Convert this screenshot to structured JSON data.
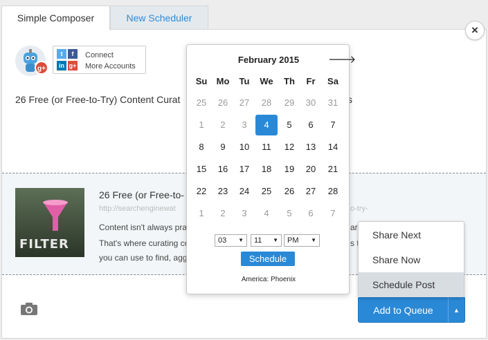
{
  "tabs": [
    {
      "label": "Simple Composer"
    },
    {
      "label": "New Scheduler"
    }
  ],
  "close": "×",
  "connect": {
    "line1": "Connect",
    "line2": "More Accounts"
  },
  "social_icons": [
    "t",
    "f",
    "in",
    "g+"
  ],
  "avatar_badge": "g+",
  "post": {
    "text": "26 Free (or Free-to-Try) Content Curat",
    "text_end": "s"
  },
  "link_preview": {
    "title": "26 Free (or Free-to-",
    "url": "http://searchenginewat",
    "url_end": "o-try-",
    "desc_lines": [
      {
        "start": "Content isn't always pra",
        "end": "ar"
      },
      {
        "start": "That's where curating co",
        "end": "s to"
      },
      {
        "start": "you can use to find, agg",
        "end": ""
      }
    ],
    "thumbnail_label": "FILTER"
  },
  "calendar": {
    "month": "February 2015",
    "next_icon": "🡒",
    "weekdays": [
      "Su",
      "Mo",
      "Tu",
      "We",
      "Th",
      "Fr",
      "Sa"
    ],
    "weeks": [
      [
        {
          "d": "25",
          "m": true
        },
        {
          "d": "26",
          "m": true
        },
        {
          "d": "27",
          "m": true
        },
        {
          "d": "28",
          "m": true
        },
        {
          "d": "29",
          "m": true
        },
        {
          "d": "30",
          "m": true
        },
        {
          "d": "31",
          "m": true
        }
      ],
      [
        {
          "d": "1",
          "m": true
        },
        {
          "d": "2",
          "m": true
        },
        {
          "d": "3",
          "m": true
        },
        {
          "d": "4",
          "m": false,
          "sel": true
        },
        {
          "d": "5",
          "m": false
        },
        {
          "d": "6",
          "m": false
        },
        {
          "d": "7",
          "m": false
        }
      ],
      [
        {
          "d": "8"
        },
        {
          "d": "9"
        },
        {
          "d": "10"
        },
        {
          "d": "11"
        },
        {
          "d": "12"
        },
        {
          "d": "13"
        },
        {
          "d": "14"
        }
      ],
      [
        {
          "d": "15"
        },
        {
          "d": "16"
        },
        {
          "d": "17"
        },
        {
          "d": "18"
        },
        {
          "d": "19"
        },
        {
          "d": "20"
        },
        {
          "d": "21"
        }
      ],
      [
        {
          "d": "22"
        },
        {
          "d": "23"
        },
        {
          "d": "24"
        },
        {
          "d": "25"
        },
        {
          "d": "26"
        },
        {
          "d": "27"
        },
        {
          "d": "28"
        }
      ],
      [
        {
          "d": "1",
          "m": true
        },
        {
          "d": "2",
          "m": true
        },
        {
          "d": "3",
          "m": true
        },
        {
          "d": "4",
          "m": true
        },
        {
          "d": "5",
          "m": true
        },
        {
          "d": "6",
          "m": true
        },
        {
          "d": "7",
          "m": true
        }
      ]
    ],
    "hour": "03",
    "minute": "11",
    "ampm": "PM",
    "select_arrow": "▼",
    "schedule_label": "Schedule",
    "timezone": "America: Phoenix"
  },
  "dropdown": {
    "items": [
      "Share Next",
      "Share Now",
      "Schedule Post"
    ],
    "active_index": 2
  },
  "queue": {
    "label": "Add to Queue",
    "caret": "▲"
  },
  "colors": {
    "accent": "#2a89d7",
    "tab_link": "#2d8ad6"
  }
}
